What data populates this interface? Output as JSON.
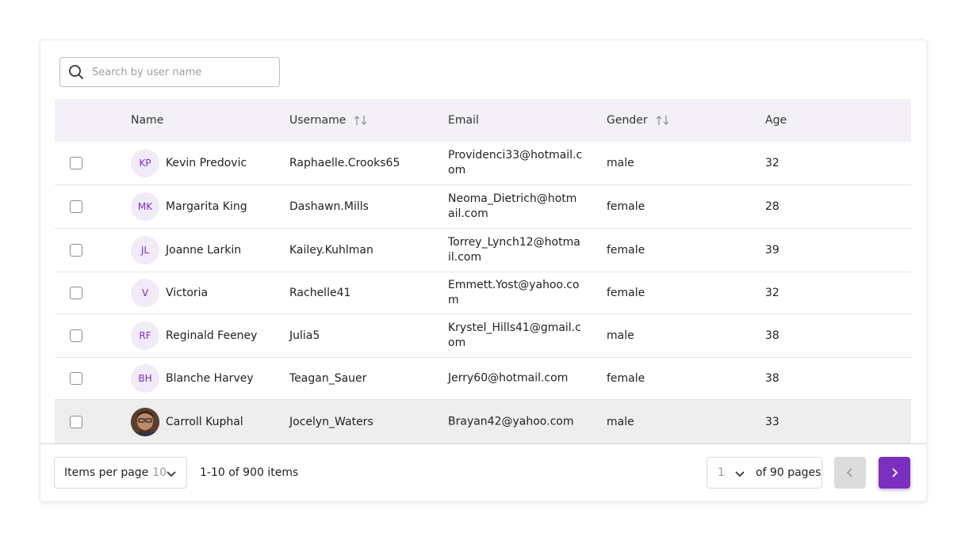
{
  "search": {
    "placeholder": "Search by user name"
  },
  "columns": {
    "name": "Name",
    "username": "Username",
    "email": "Email",
    "gender": "Gender",
    "age": "Age"
  },
  "rows": [
    {
      "initials": "KP",
      "name": "Kevin Predovic",
      "username": "Raphaelle.Crooks65",
      "email": "Providenci33@hotmail.com",
      "gender": "male",
      "age": "32"
    },
    {
      "initials": "MK",
      "name": "Margarita King",
      "username": "Dashawn.Mills",
      "email": "Neoma_Dietrich@hotmail.com",
      "gender": "female",
      "age": "28"
    },
    {
      "initials": "JL",
      "name": "Joanne Larkin",
      "username": "Kailey.Kuhlman",
      "email": "Torrey_Lynch12@hotmail.com",
      "gender": "female",
      "age": "39"
    },
    {
      "initials": "V",
      "name": "Victoria",
      "username": "Rachelle41",
      "email": "Emmett.Yost@yahoo.com",
      "gender": "female",
      "age": "32"
    },
    {
      "initials": "RF",
      "name": "Reginald Feeney",
      "username": "Julia5",
      "email": "Krystel_Hills41@gmail.com",
      "gender": "male",
      "age": "38"
    },
    {
      "initials": "BH",
      "name": "Blanche Harvey",
      "username": "Teagan_Sauer",
      "email": "Jerry60@hotmail.com",
      "gender": "female",
      "age": "38"
    },
    {
      "initials": "",
      "name": "Carroll Kuphal",
      "username": "Jocelyn_Waters",
      "email": "Brayan42@yahoo.com",
      "gender": "male",
      "age": "33"
    }
  ],
  "pagination": {
    "items_per_page_label": "Items per page",
    "items_per_page_value": "10",
    "range_text": "1-10 of 900 items",
    "current_page": "1",
    "of_pages_text": "of 90 pages"
  },
  "colors": {
    "accent": "#7b2fbf",
    "header_bg": "#f3f0f8",
    "avatar_bg": "#f0ebf7"
  }
}
